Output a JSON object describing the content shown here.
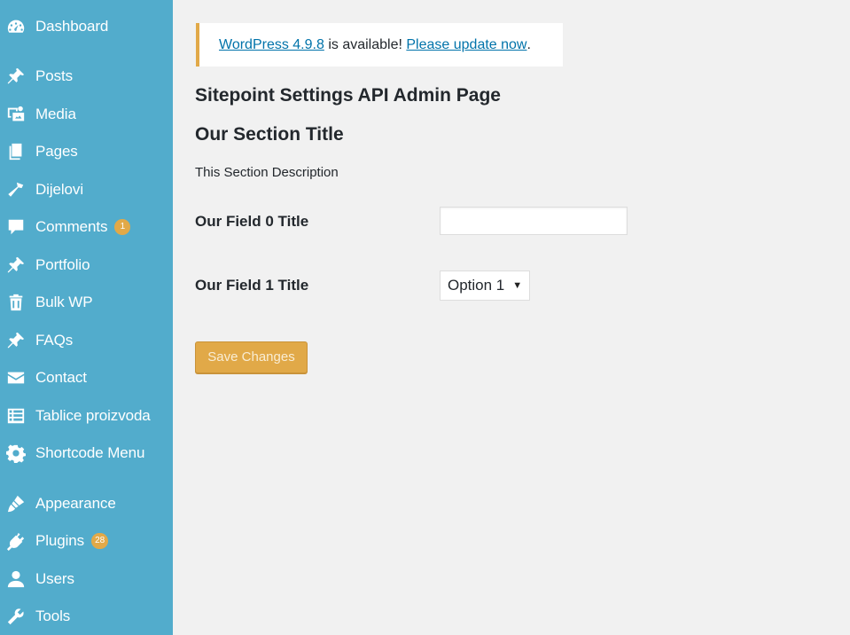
{
  "sidebar": {
    "items": [
      {
        "label": "Dashboard",
        "icon": "dashboard-icon"
      },
      {
        "label": "Posts",
        "icon": "pin-icon"
      },
      {
        "label": "Media",
        "icon": "media-icon"
      },
      {
        "label": "Pages",
        "icon": "pages-icon"
      },
      {
        "label": "Dijelovi",
        "icon": "hammer-icon"
      },
      {
        "label": "Comments",
        "icon": "comment-icon",
        "badge": "1"
      },
      {
        "label": "Portfolio",
        "icon": "pin-icon"
      },
      {
        "label": "Bulk WP",
        "icon": "trash-icon"
      },
      {
        "label": "FAQs",
        "icon": "pin-icon"
      },
      {
        "label": "Contact",
        "icon": "mail-icon"
      },
      {
        "label": "Tablice proizvoda",
        "icon": "list-icon"
      },
      {
        "label": "Shortcode Menu",
        "icon": "gear-icon"
      },
      {
        "label": "Appearance",
        "icon": "brush-icon"
      },
      {
        "label": "Plugins",
        "icon": "plug-icon",
        "badge": "28"
      },
      {
        "label": "Users",
        "icon": "user-icon"
      },
      {
        "label": "Tools",
        "icon": "wrench-icon"
      }
    ]
  },
  "notice": {
    "version_link": "WordPress 4.9.8",
    "middle_text": " is available! ",
    "update_link": "Please update now",
    "end_text": "."
  },
  "page_title": "Sitepoint Settings API Admin Page",
  "section": {
    "title": "Our Section Title",
    "description": "This Section Description"
  },
  "fields": {
    "field0_label": "Our Field 0 Title",
    "field0_value": "",
    "field1_label": "Our Field 1 Title",
    "field1_selected": "Option 1"
  },
  "save_button": "Save Changes",
  "colors": {
    "sidebar_bg": "#52accc",
    "accent": "#e1a948",
    "link": "#0073aa",
    "page_bg": "#f1f1f1"
  }
}
